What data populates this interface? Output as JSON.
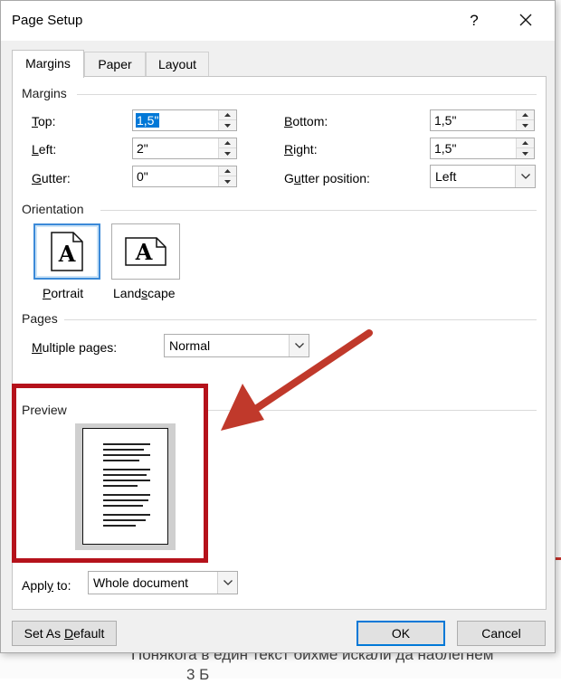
{
  "background_document": {
    "text_line_1": "Понякога в един текст бихме искали да наблегнем",
    "text_line_2": "3                          Б"
  },
  "dialog": {
    "title": "Page Setup",
    "help_label": "?",
    "tabs": [
      {
        "label": "Margins",
        "active": true
      },
      {
        "label": "Paper",
        "active": false
      },
      {
        "label": "Layout",
        "active": false
      }
    ],
    "margins": {
      "section_title": "Margins",
      "top": {
        "label_u": "T",
        "label_rest": "op:",
        "value": "1,5\""
      },
      "left": {
        "label_u": "L",
        "label_rest": "eft:",
        "value": "2\""
      },
      "gutter": {
        "label_u": "G",
        "label_rest": "utter:",
        "value": "0\""
      },
      "bottom": {
        "label_u": "B",
        "label_rest": "ottom:",
        "value": "1,5\""
      },
      "right": {
        "label_u": "R",
        "label_rest": "ight:",
        "value": "1,5\""
      },
      "gutter_position": {
        "label_pre": "G",
        "label_u": "u",
        "label_rest": "tter position:",
        "value": "Left"
      }
    },
    "orientation": {
      "section_title": "Orientation",
      "portrait": {
        "label_u": "P",
        "label_rest": "ortrait",
        "glyph": "A"
      },
      "landscape": {
        "label_pre": "Land",
        "label_u": "s",
        "label_rest": "cape",
        "glyph": "A"
      },
      "selected": "portrait"
    },
    "pages": {
      "section_title": "Pages",
      "multiple_pages": {
        "label_u": "M",
        "label_rest": "ultiple pages:",
        "value": "Normal"
      }
    },
    "preview": {
      "section_title": "Preview"
    },
    "apply_to": {
      "label_pre": "Appl",
      "label_u": "y",
      "label_rest": " to:",
      "value": "Whole document"
    },
    "buttons": {
      "set_default": {
        "label_pre": "Set As ",
        "label_u": "D",
        "label_rest": "efault"
      },
      "ok": "OK",
      "cancel": "Cancel"
    }
  },
  "colors": {
    "highlight_frame": "#b5121b",
    "arrow": "#c0392b",
    "selection": "#0078d7"
  }
}
